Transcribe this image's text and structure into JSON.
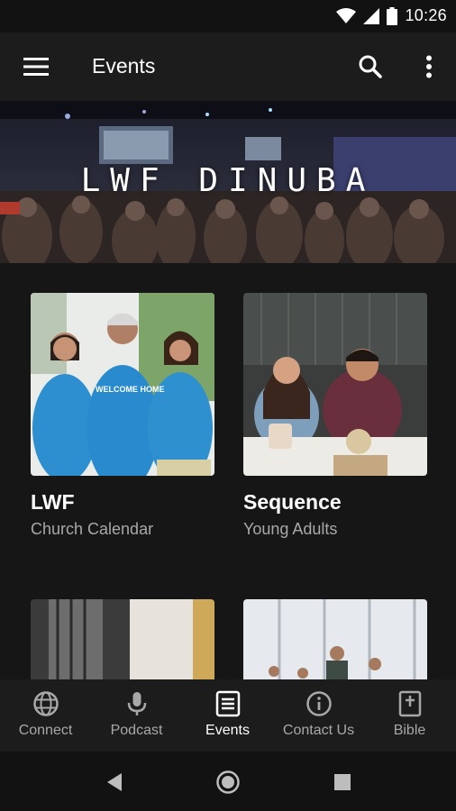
{
  "status_bar": {
    "time": "10:26"
  },
  "app_bar": {
    "title": "Events"
  },
  "hero": {
    "title": "LWF DINUBA"
  },
  "cards": [
    {
      "title": "LWF",
      "subtitle": "Church Calendar",
      "shirt_text": "WELCOME HOME"
    },
    {
      "title": "Sequence",
      "subtitle": "Young Adults"
    }
  ],
  "bottom_nav": {
    "items": [
      {
        "label": "Connect",
        "icon": "globe-icon"
      },
      {
        "label": "Podcast",
        "icon": "microphone-icon"
      },
      {
        "label": "Events",
        "icon": "calendar-icon",
        "active": true
      },
      {
        "label": "Contact Us",
        "icon": "info-icon"
      },
      {
        "label": "Bible",
        "icon": "book-icon"
      }
    ]
  },
  "colors": {
    "background": "#161616",
    "app_bar": "#1c1c1c",
    "active": "#ffffff",
    "inactive": "#a8a8a8"
  }
}
